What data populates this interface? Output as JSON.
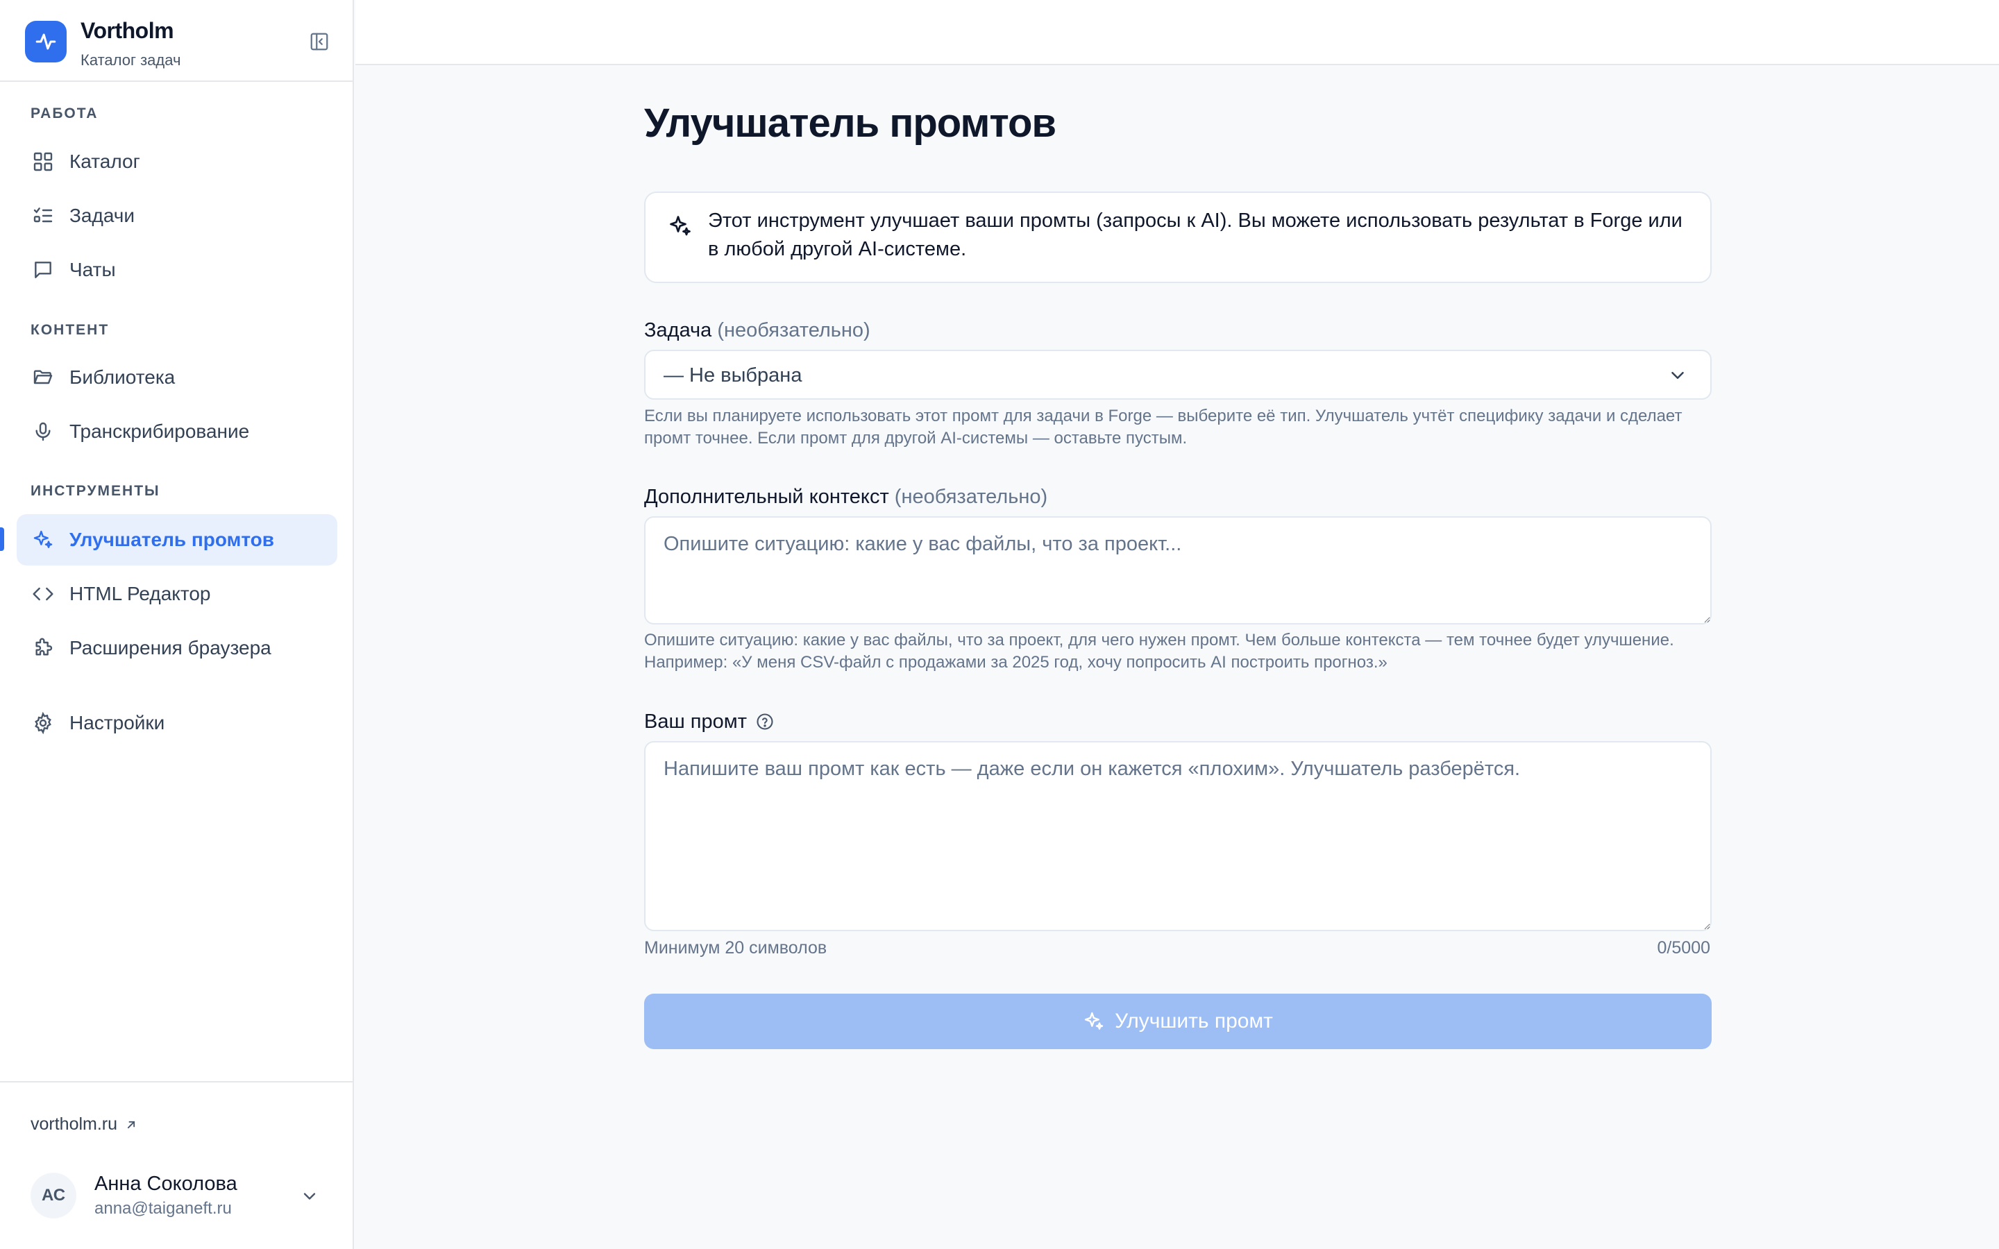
{
  "app": {
    "brand_name": "Vortholm",
    "brand_subtitle": "Каталог задач"
  },
  "sidebar": {
    "sections": [
      {
        "label": "РАБОТА"
      },
      {
        "label": "КОНТЕНТ"
      },
      {
        "label": "ИНСТРУМЕНТЫ"
      }
    ],
    "items": [
      {
        "label": "Каталог",
        "icon": "grid-icon"
      },
      {
        "label": "Задачи",
        "icon": "list-checks-icon"
      },
      {
        "label": "Чаты",
        "icon": "chat-icon"
      },
      {
        "label": "Библиотека",
        "icon": "folder-open-icon"
      },
      {
        "label": "Транскрибирование",
        "icon": "microphone-icon"
      },
      {
        "label": "Улучшатель промтов",
        "icon": "sparkles-icon",
        "active": true
      },
      {
        "label": "HTML Редактор",
        "icon": "code-icon"
      },
      {
        "label": "Расширения браузера",
        "icon": "puzzle-icon"
      },
      {
        "label": "Настройки",
        "icon": "gear-icon"
      }
    ],
    "site_link": "vortholm.ru",
    "user": {
      "initials": "АС",
      "name": "Анна Соколова",
      "email": "anna@taiganeft.ru"
    }
  },
  "main": {
    "title": "Улучшатель промтов",
    "info": "Этот инструмент улучшает ваши промты (запросы к AI). Вы можете использовать результат в Forge или в любой другой AI-системе.",
    "task_field": {
      "label": "Задача",
      "optional": "(необязательно)",
      "value": "— Не выбрана",
      "help": "Если вы планируете использовать этот промт для задачи в Forge — выберите её тип. Улучшатель учтёт специфику задачи и сделает промт точнее. Если промт для другой AI-системы — оставьте пустым."
    },
    "context_field": {
      "label": "Дополнительный контекст",
      "optional": "(необязательно)",
      "placeholder": "Опишите ситуацию: какие у вас файлы, что за проект...",
      "help_line1": "Опишите ситуацию: какие у вас файлы, что за проект, для чего нужен промт. Чем больше контекста — тем точнее будет улучшение.",
      "help_line2": "Например: «У меня CSV-файл с продажами за 2025 год, хочу попросить AI построить прогноз.»"
    },
    "prompt_field": {
      "label": "Ваш промт",
      "placeholder": "Напишите ваш промт как есть — даже если он кажется «плохим». Улучшатель разберётся.",
      "min_hint": "Минимум 20 символов",
      "counter": "0/5000"
    },
    "submit_label": "Улучшить промт"
  },
  "colors": {
    "accent": "#2f6fed",
    "active_bg": "#e8f0fe",
    "disabled_button": "#9dbdf5"
  }
}
